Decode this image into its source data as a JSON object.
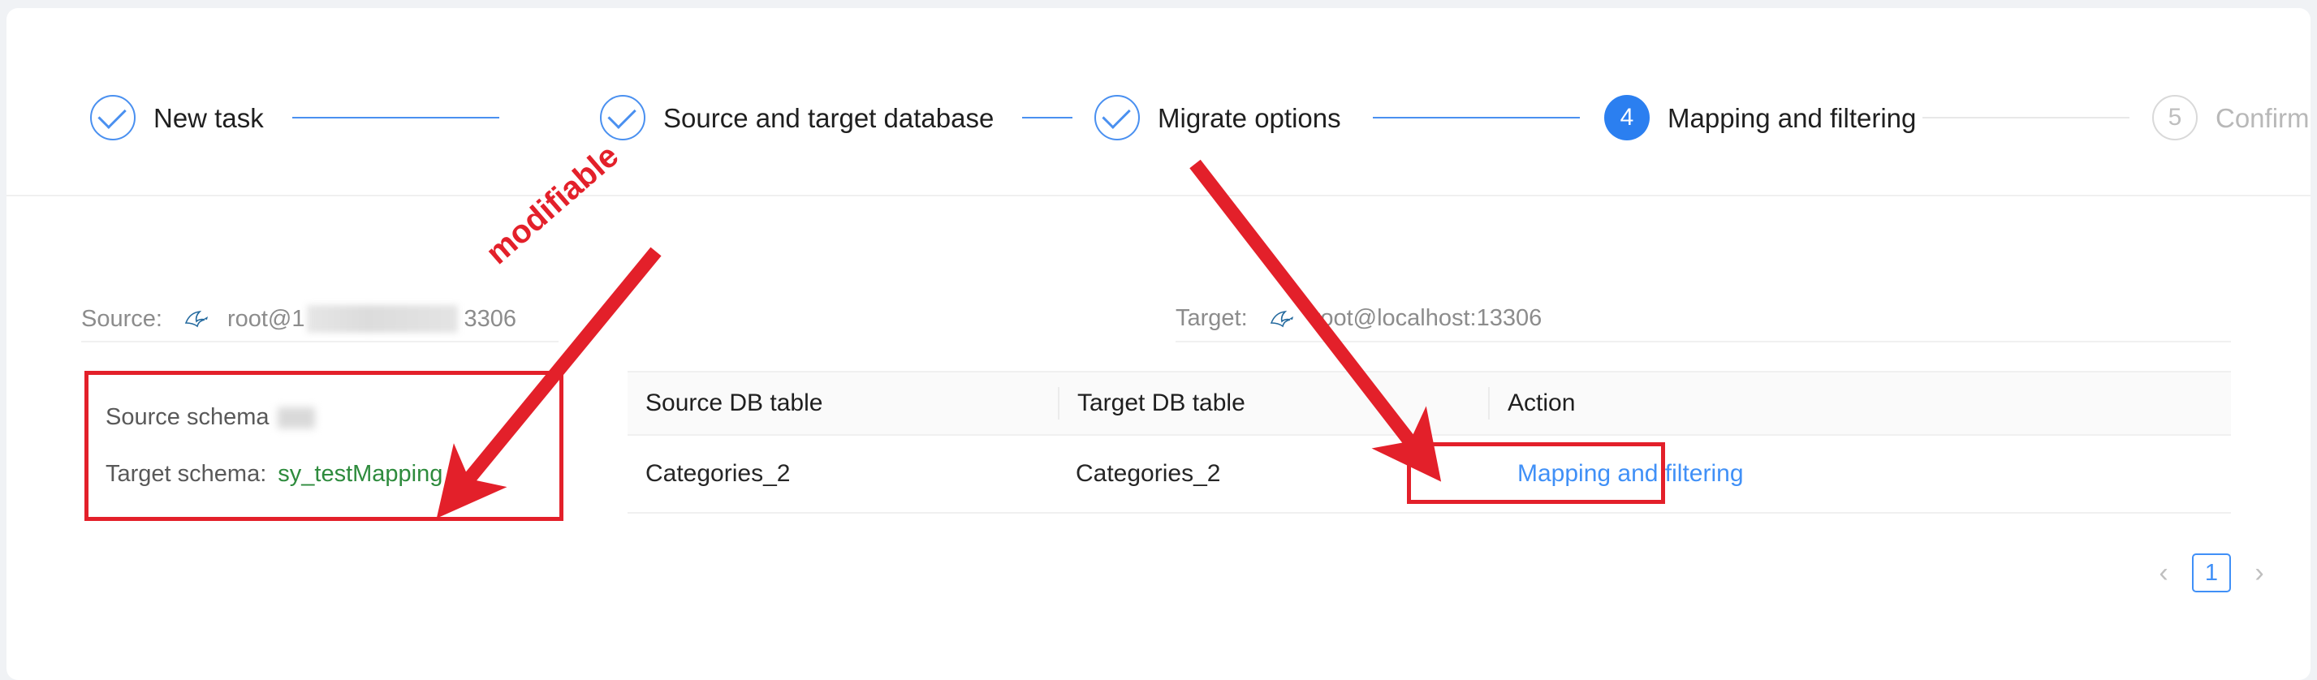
{
  "stepper": {
    "steps": [
      {
        "id": "new-task",
        "num": "1",
        "label": "New task",
        "state": "done"
      },
      {
        "id": "source-and-target-database",
        "num": "2",
        "label": "Source and target database",
        "state": "done"
      },
      {
        "id": "migrate-options",
        "num": "3",
        "label": "Migrate options",
        "state": "done"
      },
      {
        "id": "mapping-and-filtering",
        "num": "4",
        "label": "Mapping and filtering",
        "state": "active"
      },
      {
        "id": "confirm",
        "num": "5",
        "label": "Confirm",
        "state": "todo"
      }
    ]
  },
  "connection": {
    "source_label": "Source:",
    "source_user": "root@1",
    "source_port": "3306",
    "source_icon": "mysql-dolphin-icon",
    "target_label": "Target:",
    "target_host": "root@localhost:13306",
    "target_icon": "mysql-dolphin-icon"
  },
  "schema": {
    "source_key": "Source schema",
    "source_value": "",
    "target_key": "Target schema:",
    "target_value": "sy_testMapping",
    "target_value_color": "#2e8b3d"
  },
  "table": {
    "columns": [
      "Source DB table",
      "Target DB table",
      "Action"
    ],
    "rows": [
      {
        "source": "Categories_2",
        "target": "Categories_2",
        "action": "Mapping and filtering"
      }
    ]
  },
  "pagination": {
    "prev_icon": "chevron-left-icon",
    "next_icon": "chevron-right-icon",
    "current_page": "1"
  },
  "annotations": {
    "modifiable_text": "modifiable",
    "accent_color": "#e3202a"
  },
  "colors": {
    "primary": "#2b7ff0",
    "link": "#4090f7",
    "muted": "#8c8c8c",
    "annotation": "#e3202a",
    "schema_value": "#2e8b3d"
  }
}
